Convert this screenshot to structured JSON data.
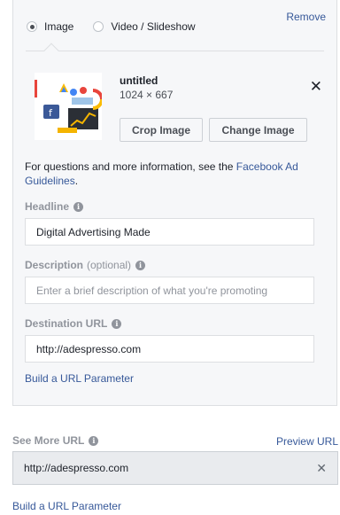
{
  "creative": {
    "remove_label": "Remove",
    "format_options": [
      {
        "label": "Image",
        "selected": true
      },
      {
        "label": "Video / Slideshow",
        "selected": false
      }
    ],
    "image": {
      "name": "untitled",
      "dimensions": "1024 × 667",
      "crop_label": "Crop Image",
      "change_label": "Change Image"
    },
    "guidelines_text": "For questions and more information, see the ",
    "guidelines_link": "Facebook Ad Guidelines",
    "guidelines_end": ".",
    "headline": {
      "label": "Headline",
      "value": "Digital Advertising Made"
    },
    "description": {
      "label": "Description",
      "optional": "(optional)",
      "placeholder": "Enter a brief description of what you're promoting"
    },
    "destination": {
      "label": "Destination URL",
      "value": "http://adespresso.com"
    },
    "build_param": "Build a URL Parameter"
  },
  "see_more": {
    "label": "See More URL",
    "preview": "Preview URL",
    "value": "http://adespresso.com",
    "build_param": "Build a URL Parameter"
  },
  "colors": {
    "link": "#365899",
    "panel": "#f6f7f9",
    "border": "#dddfe2"
  }
}
